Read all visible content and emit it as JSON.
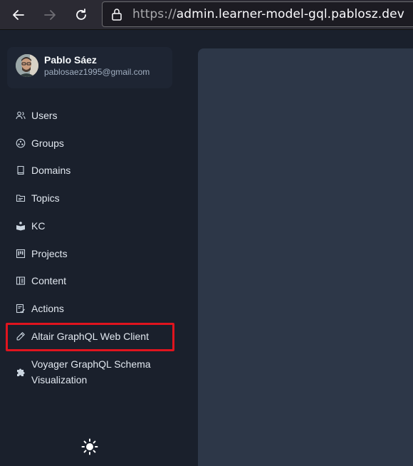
{
  "browser": {
    "url_protocol": "https://",
    "url_host": "admin.learner-model-gql.pablosz.dev"
  },
  "profile": {
    "name": "Pablo Sáez",
    "email": "pablosaez1995@gmail.com"
  },
  "nav": {
    "users": "Users",
    "groups": "Groups",
    "domains": "Domains",
    "topics": "Topics",
    "kc": "KC",
    "projects": "Projects",
    "content": "Content",
    "actions": "Actions",
    "altair": "Altair GraphQL Web Client",
    "voyager": "Voyager GraphQL Schema Visualization"
  },
  "colors": {
    "background": "#1a202c",
    "panel": "#2d3748",
    "highlight": "#e0141e"
  },
  "icons": [
    "back-arrow-icon",
    "forward-arrow-icon",
    "reload-icon",
    "lock-icon",
    "users-icon",
    "groups-icon",
    "book-icon",
    "folder-icon",
    "open-book-icon",
    "kanban-icon",
    "content-icon",
    "actions-icon",
    "pen-icon",
    "puzzle-icon",
    "sun-icon"
  ]
}
